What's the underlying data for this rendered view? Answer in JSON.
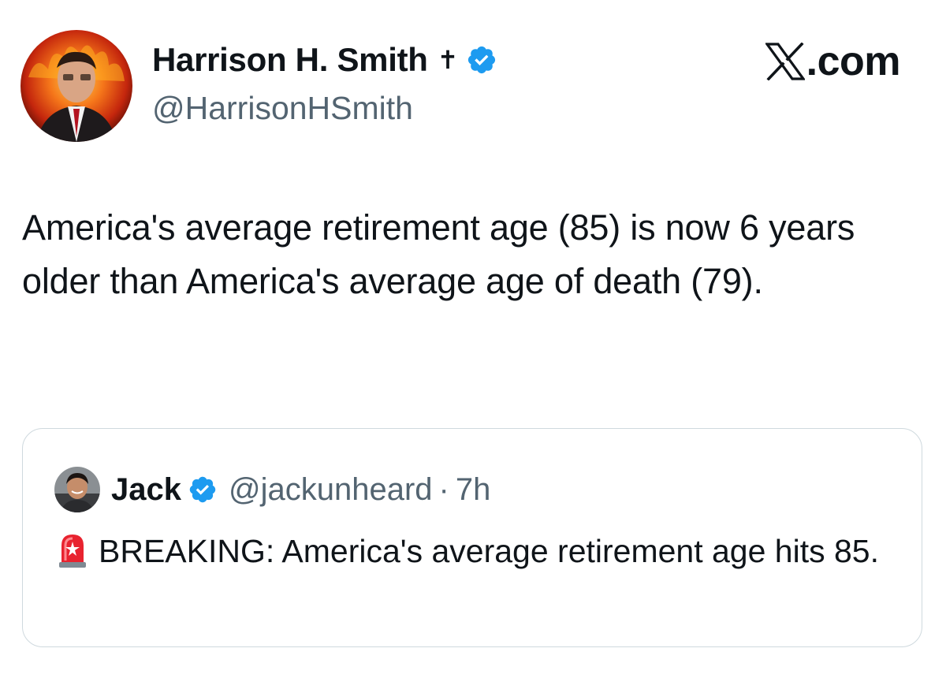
{
  "author": {
    "name": "Harrison H. Smith",
    "cross_symbol": "✝",
    "handle": "@HarrisonHSmith",
    "avatar_icon": "profile-photo-fire-background",
    "verified_icon": "verified-badge-icon"
  },
  "site": {
    "logo_icon": "x-logo-icon",
    "label": ".com"
  },
  "tweet": {
    "text": "America's average retirement age (85) is now 6 years older than America's average age of death (79)."
  },
  "quote": {
    "name": "Jack",
    "handle": "@jackunheard",
    "separator": "·",
    "time": "7h",
    "emoji_icon": "rotating-light-siren-icon",
    "text": "BREAKING: America's average retirement age hits 85."
  },
  "colors": {
    "text_primary": "#0f1419",
    "text_secondary": "#536471",
    "verified_blue": "#1d9bf0",
    "card_border": "#cfd9de"
  }
}
